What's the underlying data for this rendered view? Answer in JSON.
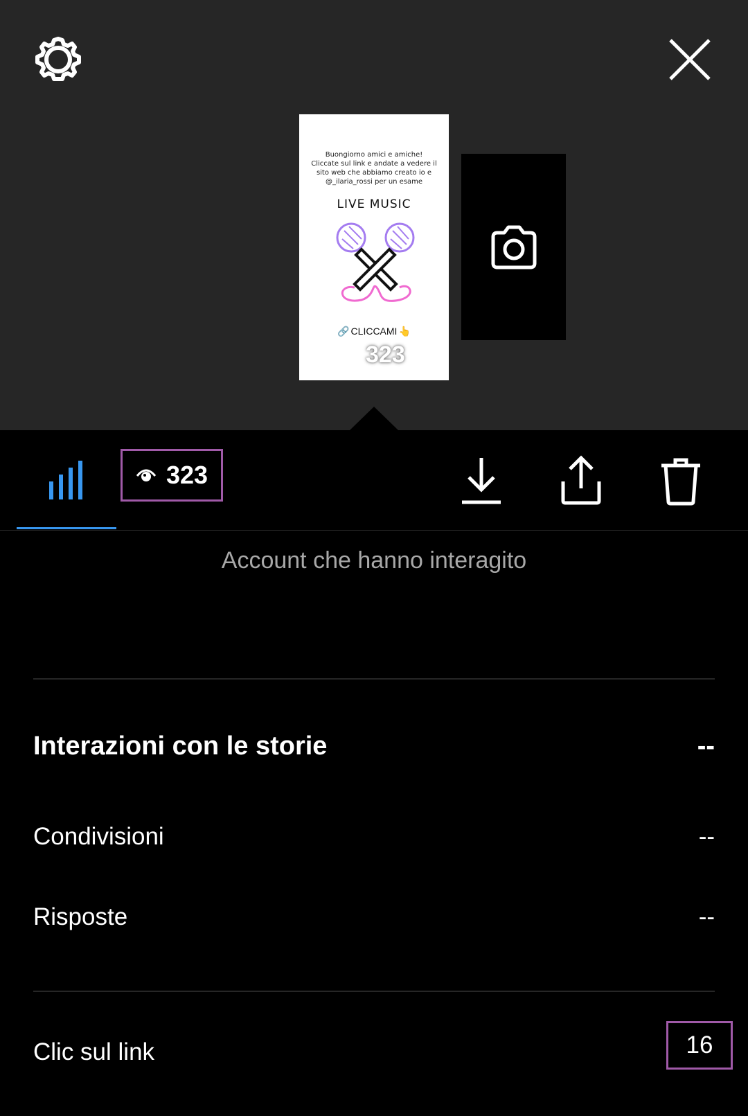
{
  "header": {
    "settings_icon": "gear-icon",
    "close_icon": "close-icon"
  },
  "story_preview": {
    "caption": "Buongiorno amici e amiche!\nCliccate sul link e andate a vedere il\nsito web che abbiamo creato io e\n@_ilaria_rossi per un esame",
    "headline": "LIVE MUSIC",
    "link_sticker": "CLICCAMI",
    "view_count": "323",
    "add_story_icon": "camera-icon",
    "colors": {
      "mic_purple": "#a47cf0",
      "cable_pink": "#f06ad0"
    }
  },
  "toolbar": {
    "insights_tab_icon": "bar-chart-icon",
    "viewers_icon": "eye-icon",
    "viewers_count": "323",
    "download_icon": "download-icon",
    "share_icon": "share-icon",
    "delete_icon": "trash-icon",
    "accent_color": "#3897f0"
  },
  "insights": {
    "subtitle": "Account che hanno interagito",
    "section_title": "Interazioni con le storie",
    "section_value": "--",
    "rows": [
      {
        "label": "Condivisioni",
        "value": "--"
      },
      {
        "label": "Risposte",
        "value": "--"
      }
    ],
    "link_clicks": {
      "label": "Clic sul link",
      "value": "16"
    }
  }
}
